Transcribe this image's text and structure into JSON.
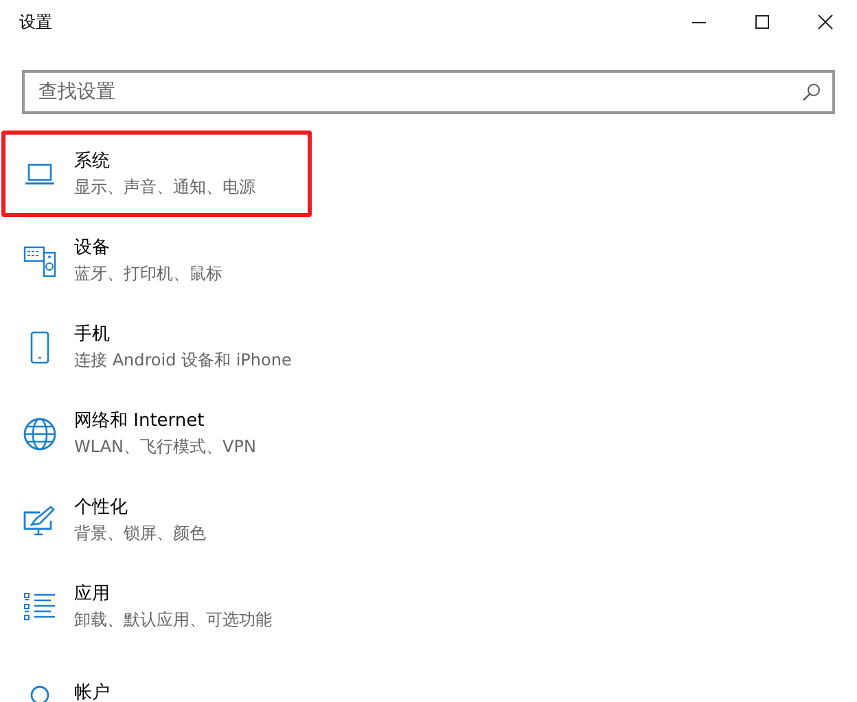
{
  "window": {
    "title": "设置"
  },
  "search": {
    "placeholder": "查找设置"
  },
  "categories": [
    {
      "kind": "laptop",
      "title": "系统",
      "subtitle": "显示、声音、通知、电源",
      "highlighted": true
    },
    {
      "kind": "devices",
      "title": "设备",
      "subtitle": "蓝牙、打印机、鼠标",
      "highlighted": false
    },
    {
      "kind": "phone",
      "title": "手机",
      "subtitle": "连接 Android 设备和 iPhone",
      "highlighted": false
    },
    {
      "kind": "globe",
      "title": "网络和 Internet",
      "subtitle": "WLAN、飞行模式、VPN",
      "highlighted": false
    },
    {
      "kind": "personalize",
      "title": "个性化",
      "subtitle": "背景、锁屏、颜色",
      "highlighted": false
    },
    {
      "kind": "apps",
      "title": "应用",
      "subtitle": "卸载、默认应用、可选功能",
      "highlighted": false
    },
    {
      "kind": "account",
      "title": "帐户",
      "highlighted": false
    }
  ]
}
